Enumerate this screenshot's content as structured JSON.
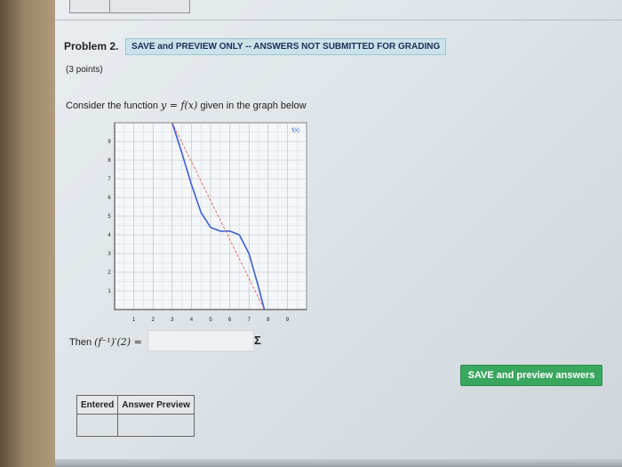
{
  "problem": {
    "title": "Problem 2.",
    "banner": "SAVE and PREVIEW ONLY -- ANSWERS NOT SUBMITTED FOR GRADING",
    "points": "(3 points)",
    "prompt_prefix": "Consider the function ",
    "prompt_function": "y = f(x)",
    "prompt_suffix": " given in the graph below"
  },
  "graph": {
    "legend": "f(x)",
    "x_ticks": [
      "1",
      "2",
      "3",
      "4",
      "5",
      "6",
      "7",
      "8",
      "9"
    ],
    "y_ticks": [
      "1",
      "2",
      "3",
      "4",
      "5",
      "6",
      "7",
      "8",
      "9"
    ]
  },
  "chart_data": {
    "type": "line",
    "xlim": [
      0,
      10
    ],
    "ylim": [
      0,
      10
    ],
    "grid": true,
    "series": [
      {
        "name": "f(x)",
        "color": "#3b5fd6",
        "x": [
          3.0,
          3.5,
          4.0,
          4.5,
          5.0,
          5.5,
          6.0,
          6.5,
          7.0,
          7.5,
          7.8
        ],
        "y": [
          10.0,
          8.4,
          6.7,
          5.2,
          4.4,
          4.2,
          4.2,
          4.0,
          3.0,
          1.2,
          0.0
        ]
      },
      {
        "name": "tangent",
        "color": "#d9534f",
        "x": [
          3.0,
          7.8
        ],
        "y": [
          10.0,
          0.0
        ]
      }
    ]
  },
  "answer": {
    "label_prefix": "Then ",
    "label_expr": "(f⁻¹)′(2) =",
    "value": "",
    "sigma": "Σ"
  },
  "save_button": "SAVE and preview answers",
  "preview_table": {
    "headers": [
      "Entered",
      "Answer Preview"
    ]
  }
}
